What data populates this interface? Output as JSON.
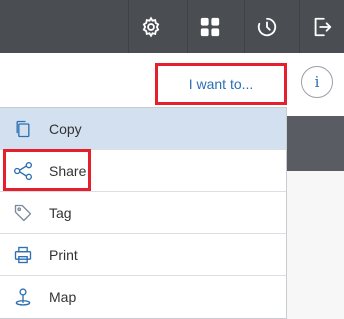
{
  "topbar": {
    "buttons": [
      {
        "icon": "gear-icon"
      },
      {
        "icon": "grid-apps-icon"
      },
      {
        "icon": "history-clock-icon"
      },
      {
        "icon": "sign-out-icon"
      }
    ]
  },
  "header": {
    "i_want_to_label": "I want to...",
    "info_label": "i"
  },
  "menu": {
    "items": [
      {
        "label": "Copy",
        "icon": "copy-icon"
      },
      {
        "label": "Share",
        "icon": "share-icon"
      },
      {
        "label": "Tag",
        "icon": "tag-icon"
      },
      {
        "label": "Print",
        "icon": "printer-icon"
      },
      {
        "label": "Map",
        "icon": "map-pin-icon"
      }
    ]
  },
  "colors": {
    "topbar": "#4a4d52",
    "link": "#2c6fb3",
    "highlight_border": "#e3202b",
    "active_row": "#d3e0ef"
  }
}
